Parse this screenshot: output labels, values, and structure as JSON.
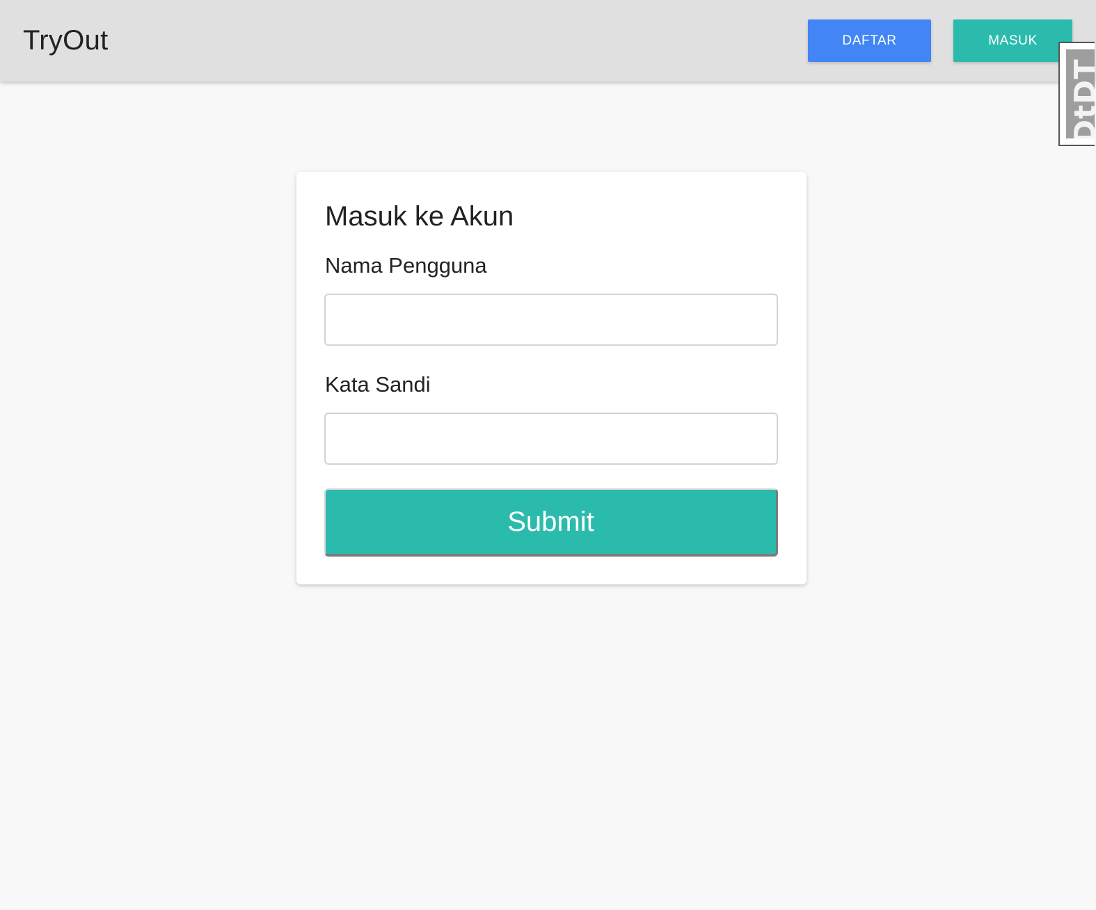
{
  "navbar": {
    "brand": "TryOut",
    "register_label": "DAFTAR",
    "login_label": "MASUK"
  },
  "badge": {
    "text": "DtDT"
  },
  "login_form": {
    "title": "Masuk ke Akun",
    "username_label": "Nama Pengguna",
    "username_value": "",
    "password_label": "Kata Sandi",
    "password_value": "",
    "submit_label": "Submit"
  },
  "colors": {
    "navbar_bg": "#e0e0e0",
    "register_button": "#4285f4",
    "login_button": "#2bbbad",
    "submit_button": "#2bbbad",
    "page_bg": "#f8f8f8"
  }
}
